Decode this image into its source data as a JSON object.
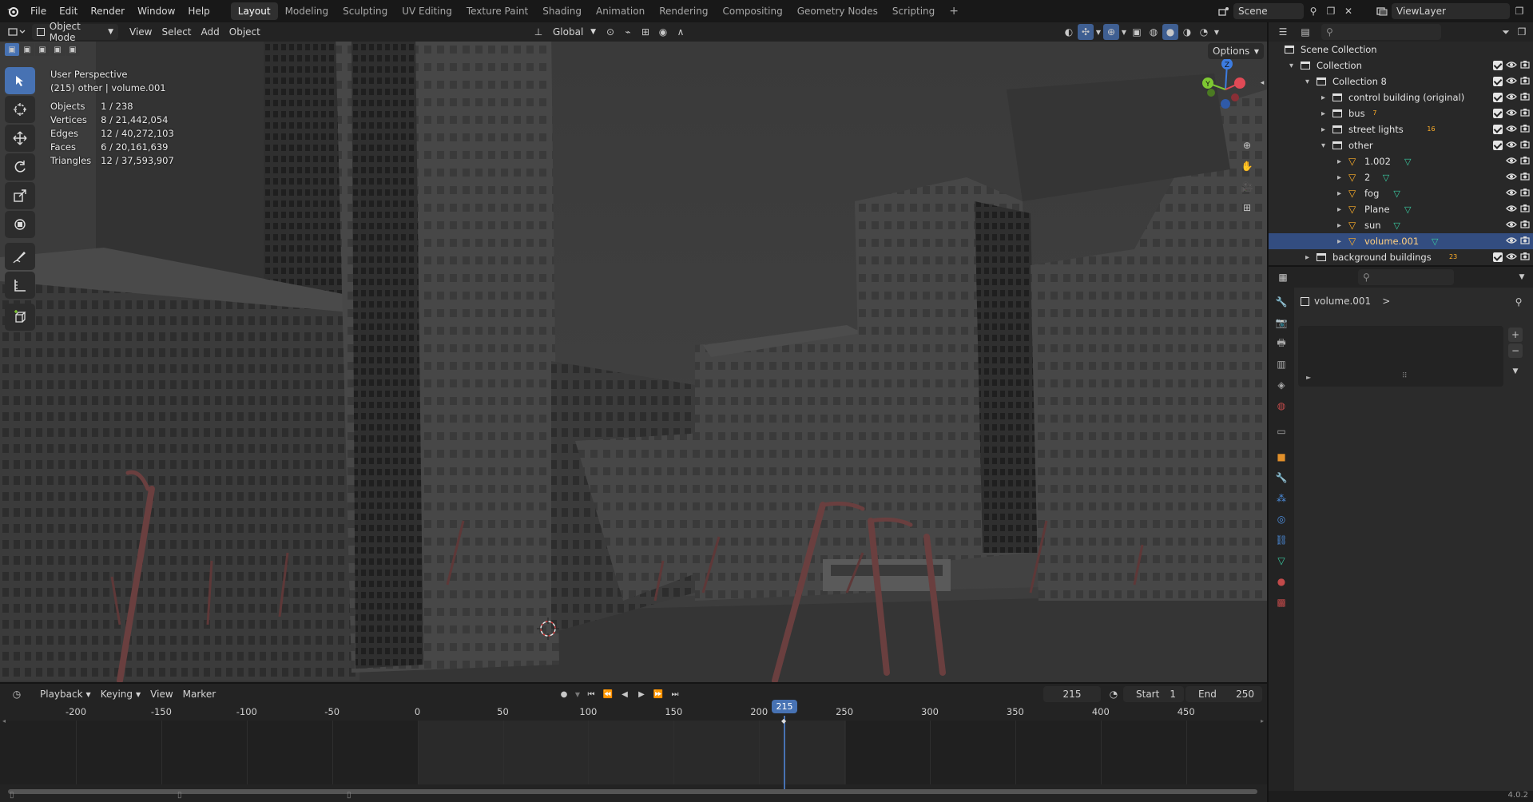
{
  "menubar": {
    "items": [
      "File",
      "Edit",
      "Render",
      "Window",
      "Help"
    ],
    "workspaces": [
      "Layout",
      "Modeling",
      "Sculpting",
      "UV Editing",
      "Texture Paint",
      "Shading",
      "Animation",
      "Rendering",
      "Compositing",
      "Geometry Nodes",
      "Scripting"
    ],
    "active_workspace": "Layout",
    "add_tab": "+",
    "scene": "Scene",
    "view_layer": "ViewLayer"
  },
  "viewport_header": {
    "mode": "Object Mode",
    "menus": [
      "View",
      "Select",
      "Add",
      "Object"
    ],
    "transform_orientation": "Global",
    "options": "Options"
  },
  "viewport": {
    "view_name": "User Perspective",
    "context": "(215) other | volume.001",
    "stats": [
      {
        "label": "Objects",
        "value": "1 / 238"
      },
      {
        "label": "Vertices",
        "value": "8 / 21,442,054"
      },
      {
        "label": "Edges",
        "value": "12 / 40,272,103"
      },
      {
        "label": "Faces",
        "value": "6 / 20,161,639"
      },
      {
        "label": "Triangles",
        "value": "12 / 37,593,907"
      }
    ],
    "gizmo_axes": {
      "z": "Z",
      "y": "Y"
    }
  },
  "outliner": {
    "rows": [
      {
        "name": "Scene Collection",
        "depth": 0,
        "kind": "scene",
        "checkbox": false,
        "eye": false,
        "cam": false
      },
      {
        "name": "Collection",
        "depth": 1,
        "kind": "collection",
        "checkbox": true,
        "eye": true,
        "cam": true,
        "expanded": true
      },
      {
        "name": "Collection 8",
        "depth": 2,
        "kind": "collection",
        "checkbox": true,
        "eye": true,
        "cam": true,
        "expanded": true
      },
      {
        "name": "control building (original)",
        "depth": 3,
        "kind": "collection",
        "checkbox": true,
        "eye": true,
        "cam": true
      },
      {
        "name": "bus",
        "depth": 3,
        "kind": "collection",
        "checkbox": true,
        "eye": true,
        "cam": true,
        "badge": "7"
      },
      {
        "name": "street lights",
        "depth": 3,
        "kind": "collection",
        "checkbox": true,
        "eye": true,
        "cam": true,
        "badge": "16"
      },
      {
        "name": "other",
        "depth": 3,
        "kind": "collection",
        "checkbox": true,
        "eye": true,
        "cam": true,
        "expanded": true
      },
      {
        "name": "1.002",
        "depth": 4,
        "kind": "object",
        "checkbox": false,
        "eye": true,
        "cam": true
      },
      {
        "name": "2",
        "depth": 4,
        "kind": "object",
        "checkbox": false,
        "eye": true,
        "cam": true
      },
      {
        "name": "fog",
        "depth": 4,
        "kind": "object",
        "checkbox": false,
        "eye": true,
        "cam": true
      },
      {
        "name": "Plane",
        "depth": 4,
        "kind": "object",
        "checkbox": false,
        "eye": true,
        "cam": true
      },
      {
        "name": "sun",
        "depth": 4,
        "kind": "object",
        "checkbox": false,
        "eye": true,
        "cam": true
      },
      {
        "name": "volume.001",
        "depth": 4,
        "kind": "object",
        "checkbox": false,
        "eye": true,
        "cam": true,
        "selected": true
      },
      {
        "name": "background buildings",
        "depth": 2,
        "kind": "collection",
        "checkbox": true,
        "eye": true,
        "cam": true,
        "badge": "23"
      }
    ]
  },
  "properties": {
    "object_name": "volume.001",
    "chevron": ">"
  },
  "timeline": {
    "menus": [
      "Playback",
      "Keying",
      "View",
      "Marker"
    ],
    "current_frame": "215",
    "start_label": "Start",
    "start_value": "1",
    "end_label": "End",
    "end_value": "250",
    "ruler": [
      "-200",
      "-150",
      "-100",
      "-50",
      "0",
      "50",
      "100",
      "150",
      "200",
      "250",
      "300",
      "350",
      "400",
      "450"
    ],
    "playhead": "215"
  },
  "statusbar": {
    "version": "4.0.2"
  },
  "colors": {
    "accent": "#4772b3",
    "selection": "#334d80",
    "active_object": "#ffaf29",
    "mesh_data": "#3acba2",
    "axis_x": "#e04a56",
    "axis_y": "#7ec832",
    "axis_z": "#3c7ce0"
  }
}
